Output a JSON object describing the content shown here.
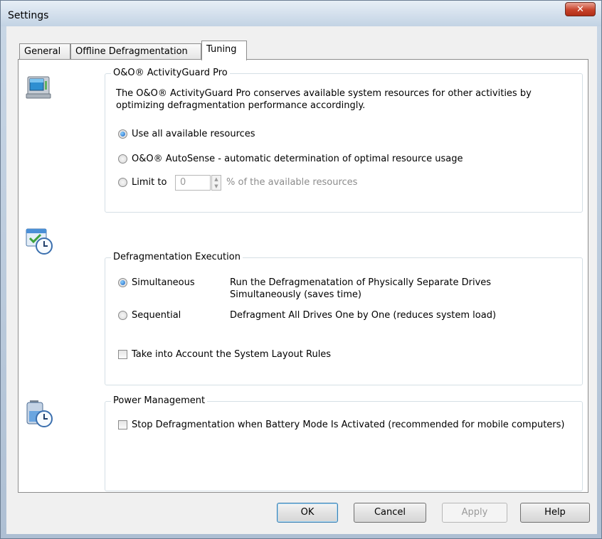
{
  "window": {
    "title": "Settings",
    "close_glyph": "✕"
  },
  "tabs": [
    {
      "label": "General"
    },
    {
      "label": "Offline Defragmentation"
    },
    {
      "label": "Tuning"
    }
  ],
  "activity_guard": {
    "legend": "O&O® ActivityGuard Pro",
    "description_line1": "The O&O® ActivityGuard Pro conserves available system resources for other activities by",
    "description_line2": "optimizing defragmentation performance accordingly.",
    "option_all": "Use all available resources",
    "option_autosense": "O&O® AutoSense - automatic determination of optimal resource usage",
    "option_limit": "Limit to",
    "limit_value": "0",
    "limit_suffix": "% of the available resources",
    "selected": "all"
  },
  "execution": {
    "legend": "Defragmentation Execution",
    "simultaneous_label": "Simultaneous",
    "simultaneous_desc_line1": "Run the Defragmenatation of Physically Separate Drives",
    "simultaneous_desc_line2": "Simultaneously (saves time)",
    "sequential_label": "Sequential",
    "sequential_desc": "Defragment All Drives One by One (reduces system load)",
    "layout_rules_label": "Take into Account the System Layout Rules",
    "selected": "simultaneous",
    "layout_rules_checked": false
  },
  "power": {
    "legend": "Power Management",
    "battery_label": "Stop Defragmentation when Battery Mode Is Activated (recommended for mobile computers)",
    "battery_checked": false
  },
  "buttons": {
    "ok": "OK",
    "cancel": "Cancel",
    "apply": "Apply",
    "help": "Help"
  },
  "icons": {
    "activity_guard": "computer-icon",
    "execution": "scheduled-window-clock-icon",
    "power": "battery-clock-icon"
  }
}
